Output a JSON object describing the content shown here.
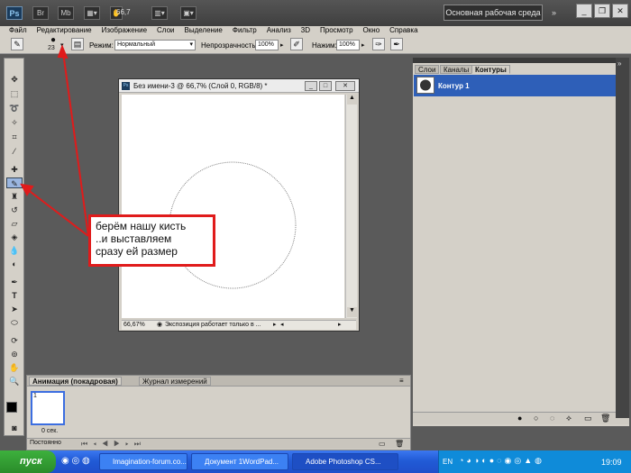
{
  "app": {
    "logo": "Ps",
    "bar_buttons": [
      "Br",
      "Mb"
    ],
    "zoom": "66,7",
    "workspace": "Основная рабочая среда",
    "expand": "»",
    "window_controls": [
      "_",
      "❐",
      "✕"
    ]
  },
  "menu": [
    "Файл",
    "Редактирование",
    "Изображение",
    "Слои",
    "Выделение",
    "Фильтр",
    "Анализ",
    "3D",
    "Просмотр",
    "Окно",
    "Справка"
  ],
  "options": {
    "brush_size": "23",
    "mode_label": "Режим:",
    "mode_value": "Нормальный",
    "opacity_label": "Непрозрачность:",
    "opacity_value": "100%",
    "pressure_label": "Нажим:",
    "pressure_value": "100%"
  },
  "document": {
    "title": "Без имени-3 @ 66,7% (Слой 0, RGB/8) *",
    "zoom": "66,67%",
    "status": "Экспозиция работает только в ..."
  },
  "panels": {
    "tabs": [
      "Слои",
      "Каналы",
      "Контуры"
    ],
    "active_tab": "Контуры",
    "path_name": "Контур 1"
  },
  "animation": {
    "tabs": [
      "Анимация (покадровая)",
      "Журнал измерений"
    ],
    "frame_number": "1",
    "frame_delay": "0 сек.",
    "loop": "Постоянно"
  },
  "annotation": {
    "lines": [
      "берём нашу кисть",
      "..и выставляем",
      "сразу ей размер"
    ],
    "color": "#e01b1b"
  },
  "taskbar": {
    "start": "пуск",
    "items": [
      "Imagination-forum.co...",
      "Документ 1WordPad...",
      "Adobe Photoshop CS..."
    ],
    "lang": "EN",
    "clock": "19:09"
  }
}
